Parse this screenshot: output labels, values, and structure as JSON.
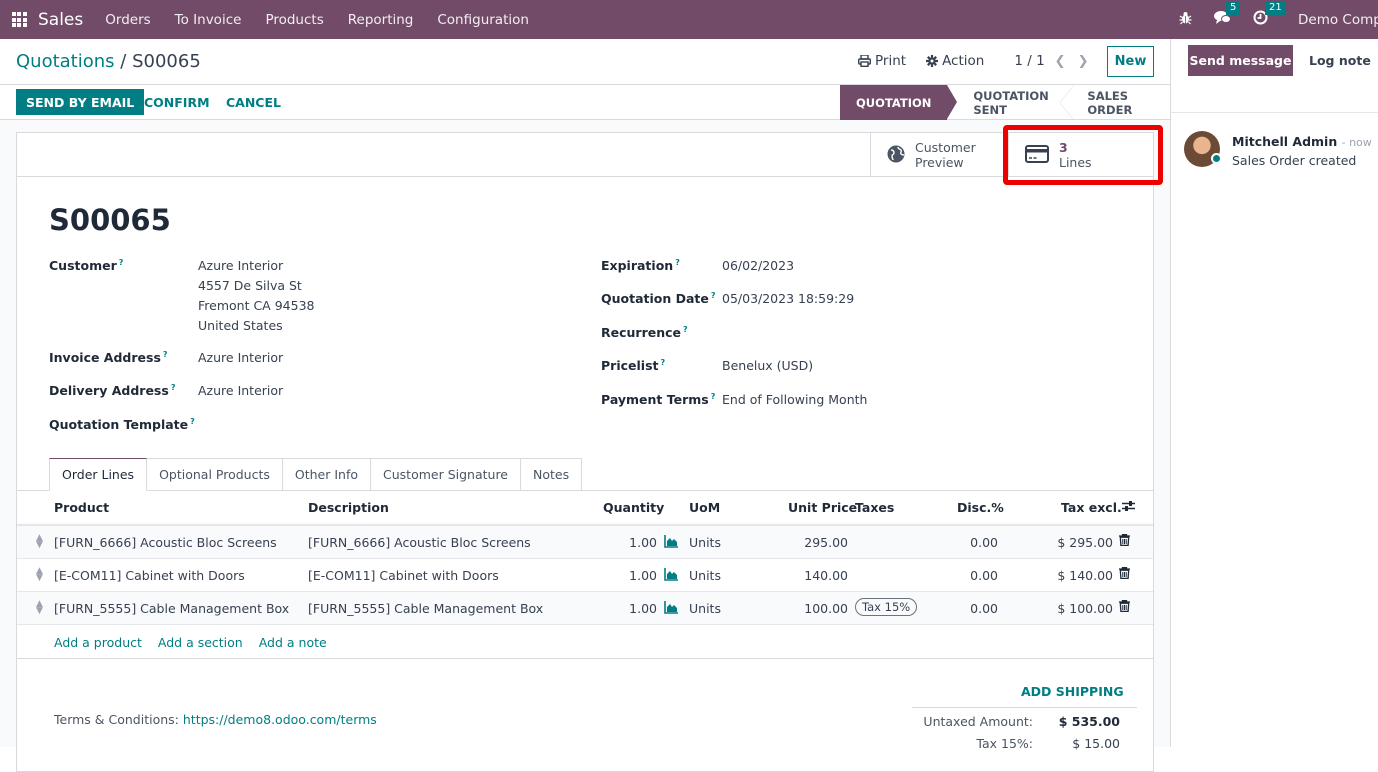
{
  "navbar": {
    "app_icon": "apps-grid-icon",
    "app_name": "Sales",
    "menu": [
      "Orders",
      "To Invoice",
      "Products",
      "Reporting",
      "Configuration"
    ],
    "debug_icon": "bug-icon",
    "messages_icon": "chat-icon",
    "messages_count": "5",
    "activities_icon": "clock-icon",
    "activities_count": "21",
    "company": "Demo Company"
  },
  "control_panel": {
    "breadcrumb_parent": "Quotations",
    "breadcrumb_sep": "/",
    "breadcrumb_current": "S00065",
    "print_label": "Print",
    "action_label": "Action",
    "pager": "1 / 1",
    "new_label": "New",
    "buttons": {
      "send_email": "SEND BY EMAIL",
      "confirm": "CONFIRM",
      "cancel": "CANCEL"
    },
    "stages": [
      "QUOTATION",
      "QUOTATION SENT",
      "SALES ORDER"
    ],
    "active_stage": "QUOTATION"
  },
  "smart_buttons": {
    "preview_line1": "Customer",
    "preview_line2": "Preview",
    "lines_value": "3",
    "lines_label": "Lines"
  },
  "record": {
    "name": "S00065",
    "help_marker": "?",
    "left_fields": {
      "customer_label": "Customer",
      "customer_lines": [
        "Azure Interior",
        "4557 De Silva St",
        "Fremont CA 94538",
        "United States"
      ],
      "invoice_label": "Invoice Address",
      "invoice_value": "Azure Interior",
      "delivery_label": "Delivery Address",
      "delivery_value": "Azure Interior",
      "template_label": "Quotation Template",
      "template_value": ""
    },
    "right_fields": {
      "expiration_label": "Expiration",
      "expiration_value": "06/02/2023",
      "date_label": "Quotation Date",
      "date_value": "05/03/2023 18:59:29",
      "recurrence_label": "Recurrence",
      "recurrence_value": "",
      "pricelist_label": "Pricelist",
      "pricelist_value": "Benelux (USD)",
      "terms_label": "Payment Terms",
      "terms_value": "End of Following Month"
    }
  },
  "tabs": [
    "Order Lines",
    "Optional Products",
    "Other Info",
    "Customer Signature",
    "Notes"
  ],
  "active_tab": "Order Lines",
  "order_lines": {
    "columns": [
      "Product",
      "Description",
      "Quantity",
      "UoM",
      "Unit Price",
      "Taxes",
      "Disc.%",
      "Tax excl."
    ],
    "rows": [
      {
        "product": "[FURN_6666] Acoustic Bloc Screens",
        "description": "[FURN_6666] Acoustic Bloc Screens",
        "quantity": "1.00",
        "uom": "Units",
        "unit_price": "295.00",
        "taxes": "",
        "discount": "0.00",
        "subtotal": "$ 295.00"
      },
      {
        "product": "[E-COM11] Cabinet with Doors",
        "description": "[E-COM11] Cabinet with Doors",
        "quantity": "1.00",
        "uom": "Units",
        "unit_price": "140.00",
        "taxes": "",
        "discount": "0.00",
        "subtotal": "$ 140.00"
      },
      {
        "product": "[FURN_5555] Cable Management Box",
        "description": "[FURN_5555] Cable Management Box",
        "quantity": "1.00",
        "uom": "Units",
        "unit_price": "100.00",
        "taxes": "Tax 15%",
        "discount": "0.00",
        "subtotal": "$ 100.00"
      }
    ],
    "add_links": [
      "Add a product",
      "Add a section",
      "Add a note"
    ]
  },
  "footer": {
    "add_shipping": "ADD SHIPPING",
    "terms_label": "Terms & Conditions:",
    "terms_link": "https://demo8.odoo.com/terms",
    "untaxed_label": "Untaxed Amount:",
    "untaxed_value": "$ 535.00",
    "tax_label": "Tax 15%:",
    "tax_value": "$ 15.00"
  },
  "chatter": {
    "send_message": "Send message",
    "log_note": "Log note",
    "messages": [
      {
        "author": "Mitchell Admin",
        "time": "- now",
        "body": "Sales Order created"
      }
    ]
  },
  "colors": {
    "brand": "#714b67",
    "accent": "#017e84",
    "highlight": "#ee0000"
  }
}
